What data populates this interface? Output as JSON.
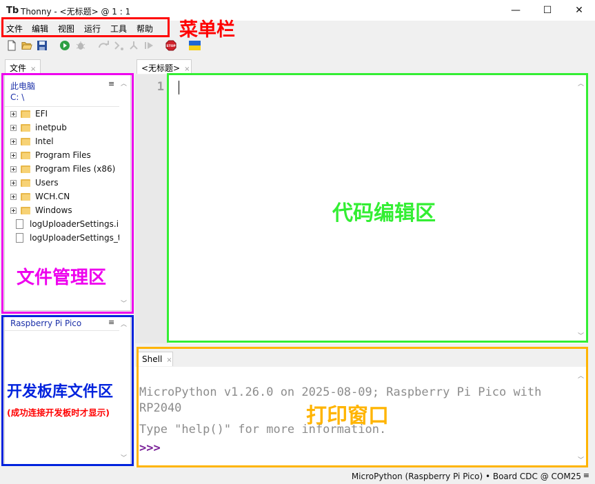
{
  "window": {
    "title": "Thonny  -  <无标题>  @  1 : 1",
    "app_icon": "Tb",
    "minimize": "—",
    "maximize": "☐",
    "close": "✕"
  },
  "menu": {
    "items": [
      "文件",
      "编辑",
      "视图",
      "运行",
      "工具",
      "帮助"
    ]
  },
  "toolbar": {
    "icons": [
      "new-file-icon",
      "open-folder-icon",
      "save-icon",
      "run-icon",
      "debug-icon",
      "step-over-icon",
      "step-into-icon",
      "step-out-icon",
      "resume-icon",
      "stop-icon",
      "ukraine-flag-icon"
    ],
    "stop_label": "STOP"
  },
  "files_panel": {
    "tab_label": "文件",
    "tab_close": "×",
    "section_title": "此电脑",
    "path": "C: \\",
    "menu_icon": "≡",
    "entries": [
      {
        "name": "EFI",
        "type": "folder"
      },
      {
        "name": "inetpub",
        "type": "folder"
      },
      {
        "name": "Intel",
        "type": "folder"
      },
      {
        "name": "Program Files",
        "type": "folder"
      },
      {
        "name": "Program Files (x86)",
        "type": "folder"
      },
      {
        "name": "Users",
        "type": "folder"
      },
      {
        "name": "WCH.CN",
        "type": "folder"
      },
      {
        "name": "Windows",
        "type": "folder"
      },
      {
        "name": "logUploaderSettings.i",
        "type": "file"
      },
      {
        "name": "logUploaderSettings_t",
        "type": "file"
      }
    ],
    "device_title": "Raspberry Pi Pico",
    "device_menu_icon": "≡"
  },
  "editor": {
    "tab_label": "<无标题>",
    "tab_close": "×",
    "line_number": "1"
  },
  "shell": {
    "tab_label": "Shell",
    "tab_close": "×",
    "line1": "MicroPython v1.26.0 on 2025-08-09; Raspberry Pi Pico with",
    "line2": "RP2040",
    "line3": "Type \"help()\" for more information.",
    "prompt": ">>>"
  },
  "statusbar": {
    "text": "MicroPython (Raspberry Pi Pico)  •  Board CDC @ COM25",
    "menu_icon": "≡"
  },
  "annotations": {
    "menu_bar": {
      "label": "菜单栏",
      "color": "#ff0000"
    },
    "file_manager": {
      "label": "文件管理区",
      "color": "#ee00ee"
    },
    "device_files": {
      "label": "开发板库文件区",
      "sublabel": "(成功连接开发板时才显示)",
      "color": "#0022dd",
      "sublabel_color": "#ff0000"
    },
    "code_editor": {
      "label": "代码编辑区",
      "color": "#33ee33"
    },
    "print_window": {
      "label": "打印窗口",
      "color": "#ffb400"
    }
  }
}
